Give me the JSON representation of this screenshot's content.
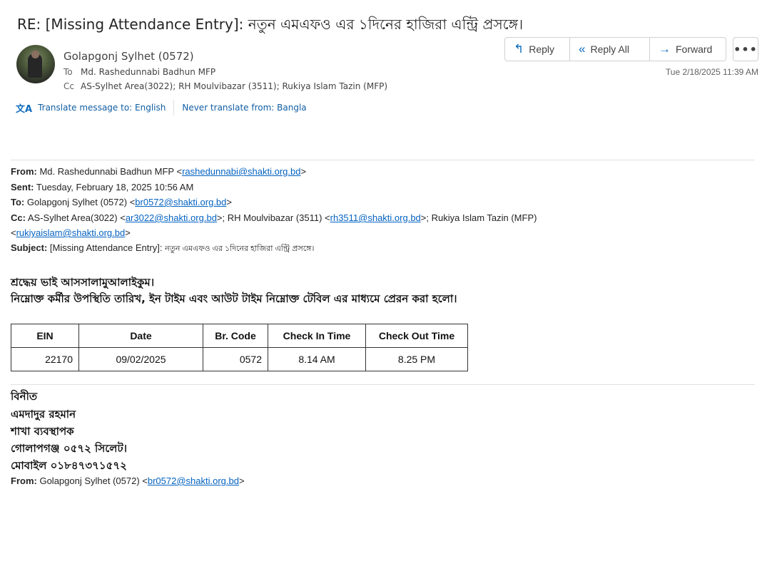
{
  "subject": "RE: [Missing Attendance Entry]: নতুন এমএফও এর ১দিনের  হাজিরা এন্ট্রি প্রসঙ্গে।",
  "header": {
    "sender": "Golapgonj Sylhet (0572)",
    "to_label": "To",
    "to": "Md. Rashedunnabi Badhun MFP",
    "cc_label": "Cc",
    "cc": "AS-Sylhet Area(3022); RH Moulvibazar (3511); Rukiya Islam Tazin (MFP)",
    "date": "Tue 2/18/2025 11:39 AM"
  },
  "actions": {
    "reply": "Reply",
    "reply_all": "Reply All",
    "forward": "Forward",
    "more": "•••"
  },
  "translate": {
    "translate_link": "Translate message to: English",
    "never_link": "Never translate from: Bangla"
  },
  "quoted": {
    "from_label": "From:",
    "from_name": "Md. Rashedunnabi Badhun MFP <",
    "from_email": "rashedunnabi@shakti.org.bd",
    "sent_label": "Sent:",
    "sent": "Tuesday, February 18, 2025 10:56 AM",
    "to_label": "To:",
    "to_name": "Golapgonj Sylhet (0572) <",
    "to_email": "br0572@shakti.org.bd",
    "cc_label": "Cc:",
    "cc_1": "AS-Sylhet Area(3022) <",
    "cc_1_email": "ar3022@shakti.org.bd",
    "cc_2": ">; RH Moulvibazar (3511) <",
    "cc_2_email": "rh3511@shakti.org.bd",
    "cc_3": ">; Rukiya Islam Tazin (MFP)",
    "cc_3_email": "rukiyaislam@shakti.org.bd",
    "subject_label": "Subject:",
    "subject_en": "[Missing Attendance Entry]:",
    "subject_bn": "নতুন এমএফও এর ১দিনের হাজিরা এন্ট্রি প্রসঙ্গে।"
  },
  "body": {
    "greeting": "শ্রদ্ধেয় ভাই আসসালামুআলাইকুম।",
    "line": "নিম্নোক্ত কর্মীর উপস্থিতি তারিখ, ইন টাইম এবং আউট টাইম নিম্নোক্ত টেবিল এর মাধ্যমে প্রেরন করা হলো।"
  },
  "table": {
    "headers": [
      "EIN",
      "Date",
      "Br. Code",
      "Check In Time",
      "Check Out Time"
    ],
    "rows": [
      [
        "22170",
        "09/02/2025",
        "0572",
        "8.14 AM",
        "8.25 PM"
      ]
    ]
  },
  "signature": {
    "line1": "বিনীত",
    "line2": "এমদাদুর রহমান",
    "line3": "শাখা ব্যবস্থাপক",
    "line4": "গোলাপগঞ্জ ০৫৭২ সিলেট।",
    "line5": "মোবাইল ০১৮৪৭৩৭১৫৭২"
  },
  "quoted2": {
    "from_label": "From:",
    "from_name": "Golapgonj Sylhet (0572) <",
    "from_email": "br0572@shakti.org.bd"
  }
}
